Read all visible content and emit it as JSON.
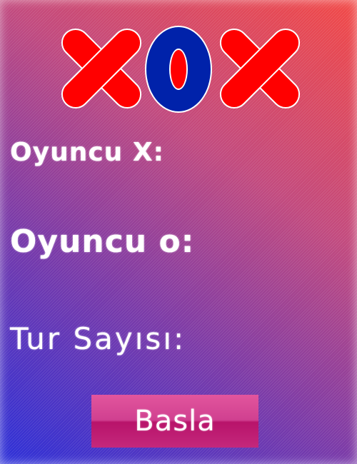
{
  "logo": {
    "letters": [
      "X",
      "O",
      "X"
    ],
    "colors": {
      "x_fill": "#ff0000",
      "o_fill": "#0022aa",
      "o_inner": "#ff0000",
      "outline": "#ffffff"
    }
  },
  "labels": {
    "player_x": "Oyuncu X:",
    "player_o": "Oyuncu o:",
    "rounds": "Tur Sayısı:"
  },
  "button": {
    "start_label": "Basla"
  },
  "colors": {
    "background_start": "#2b2fd8",
    "background_end": "#f24845",
    "button": "#c4287c",
    "text": "#ffffff"
  }
}
